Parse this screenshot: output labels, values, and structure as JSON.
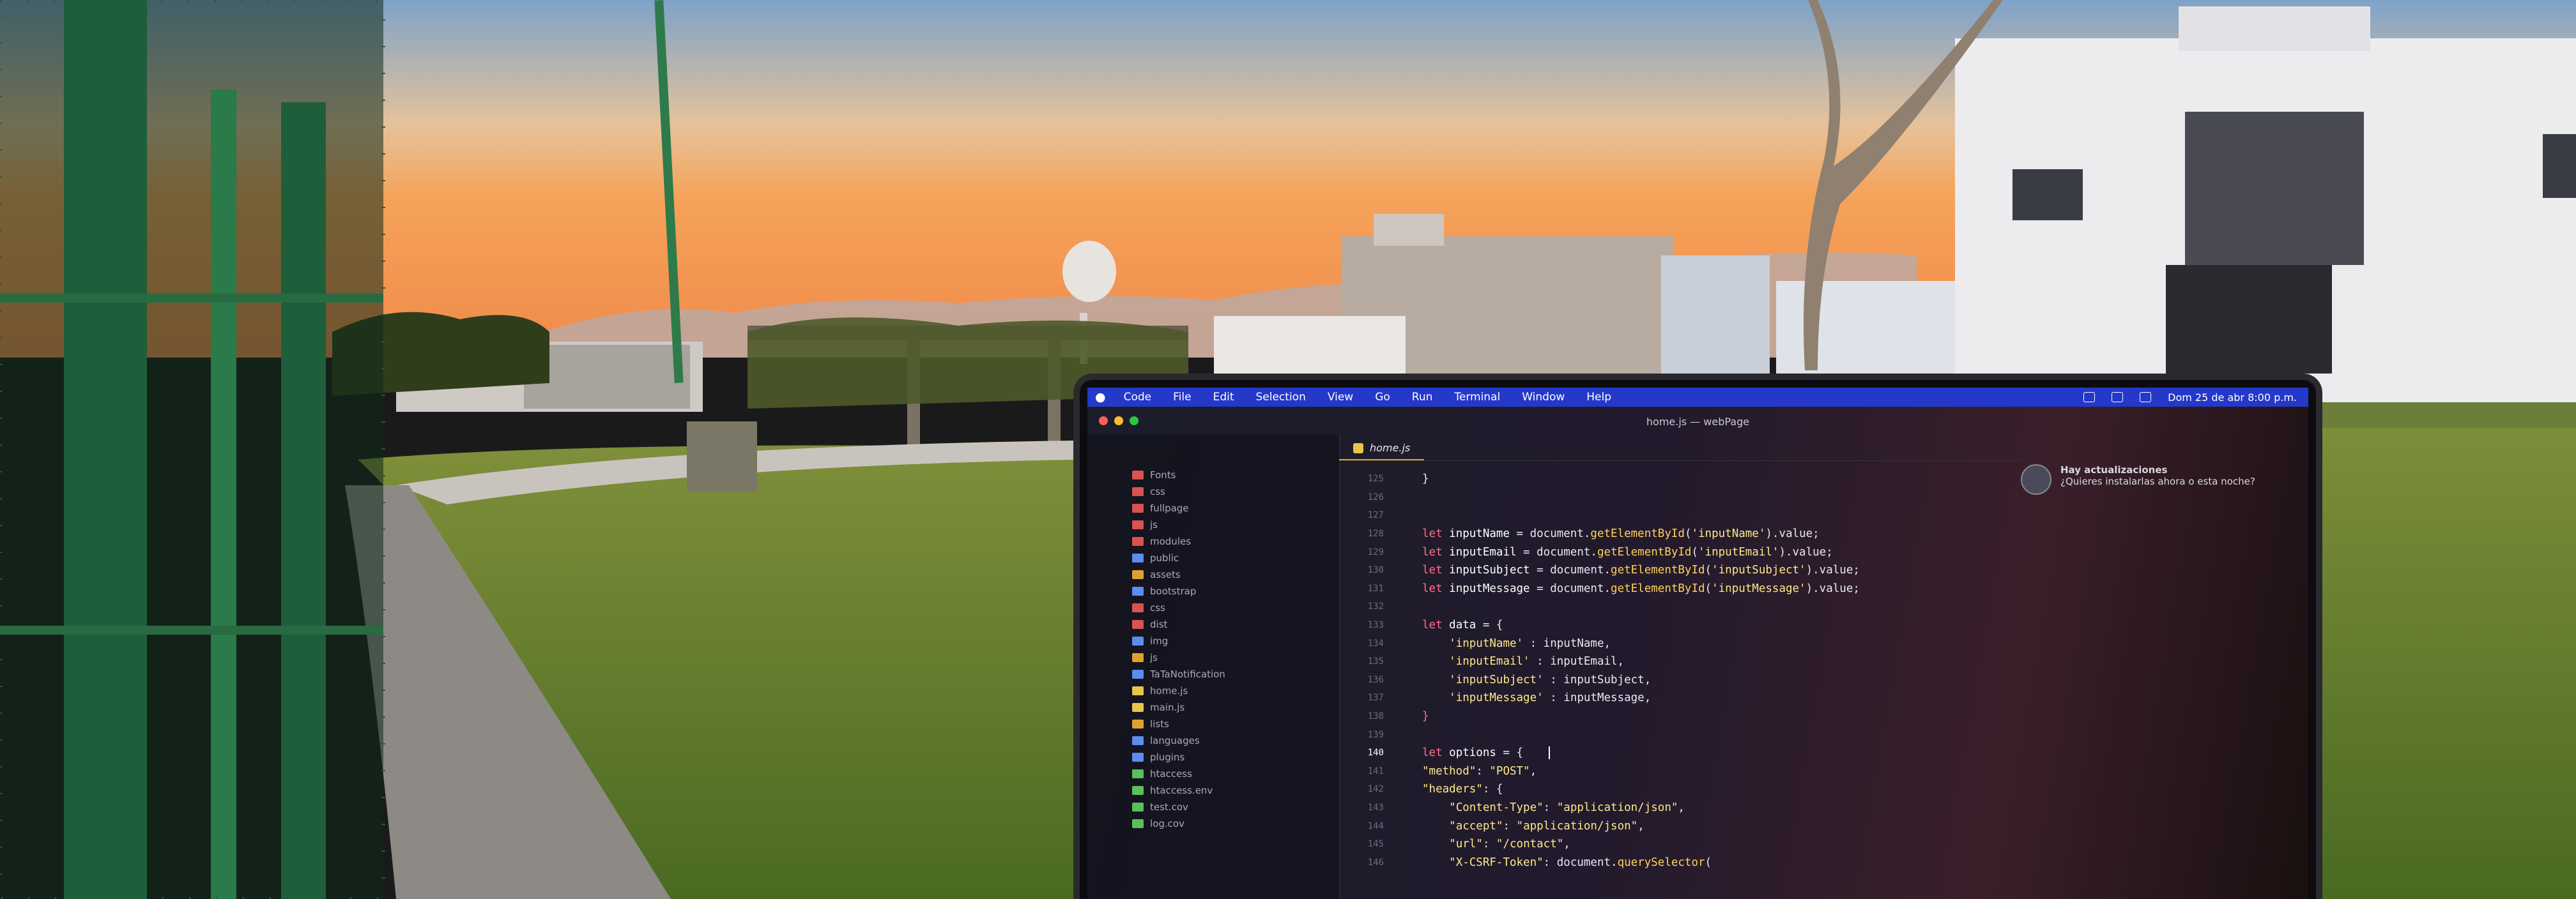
{
  "scene": {
    "description_colors": {
      "sky_top": "#7ea3c9",
      "sky_horizon": "#f5a35a",
      "grass": "#5b7a2a",
      "fence": "#1f5e3a"
    }
  },
  "laptop": {
    "menubar": {
      "items": [
        "Code",
        "File",
        "Edit",
        "Selection",
        "View",
        "Go",
        "Run",
        "Terminal",
        "Window",
        "Help"
      ],
      "datetime": "Dom 25 de abr  8:00 p.m."
    },
    "window_title": "home.js — webPage",
    "tab_label": "home.js",
    "notification": {
      "title": "Hay actualizaciones",
      "body": "¿Quieres instalarlas ahora o esta noche?"
    },
    "explorer": [
      {
        "label": "Fonts",
        "color": "#d9534f"
      },
      {
        "label": "css",
        "color": "#d9534f"
      },
      {
        "label": "fullpage",
        "color": "#d9534f"
      },
      {
        "label": "js",
        "color": "#d9534f"
      },
      {
        "label": "modules",
        "color": "#d9534f"
      },
      {
        "label": "public",
        "color": "#5b8def"
      },
      {
        "label": "assets",
        "color": "#e0a030"
      },
      {
        "label": "bootstrap",
        "color": "#5b8def"
      },
      {
        "label": "css",
        "color": "#d9534f"
      },
      {
        "label": "dist",
        "color": "#d9534f"
      },
      {
        "label": "img",
        "color": "#5b8def"
      },
      {
        "label": "js",
        "color": "#e0a030"
      },
      {
        "label": "TaTaNotification",
        "color": "#5b8def"
      },
      {
        "label": "home.js",
        "color": "#e8c44a"
      },
      {
        "label": "main.js",
        "color": "#e8c44a"
      },
      {
        "label": "lists",
        "color": "#e0a030"
      },
      {
        "label": "languages",
        "color": "#5b8def"
      },
      {
        "label": "plugins",
        "color": "#5b8def"
      },
      {
        "label": "htaccess",
        "color": "#5bbf5b"
      },
      {
        "label": "htaccess.env",
        "color": "#5bbf5b"
      },
      {
        "label": "test.cov",
        "color": "#5bbf5b"
      },
      {
        "label": "log.cov",
        "color": "#5bbf5b"
      }
    ],
    "code_lines": [
      {
        "n": "125",
        "tokens": [
          [
            "pun",
            "}"
          ]
        ]
      },
      {
        "n": "126",
        "tokens": []
      },
      {
        "n": "127",
        "tokens": []
      },
      {
        "n": "128",
        "tokens": [
          [
            "kw",
            "let "
          ],
          [
            "var",
            "inputName"
          ],
          [
            "pun",
            " = document."
          ],
          [
            "fn",
            "getElementById"
          ],
          [
            "pun",
            "("
          ],
          [
            "str",
            "'inputName'"
          ],
          [
            "pun",
            ").value;"
          ]
        ]
      },
      {
        "n": "129",
        "tokens": [
          [
            "kw",
            "let "
          ],
          [
            "var",
            "inputEmail"
          ],
          [
            "pun",
            " = document."
          ],
          [
            "fn",
            "getElementById"
          ],
          [
            "pun",
            "("
          ],
          [
            "str",
            "'inputEmail'"
          ],
          [
            "pun",
            ").value;"
          ]
        ]
      },
      {
        "n": "130",
        "tokens": [
          [
            "kw",
            "let "
          ],
          [
            "var",
            "inputSubject"
          ],
          [
            "pun",
            " = document."
          ],
          [
            "fn",
            "getElementById"
          ],
          [
            "pun",
            "("
          ],
          [
            "str",
            "'inputSubject'"
          ],
          [
            "pun",
            ").value;"
          ]
        ]
      },
      {
        "n": "131",
        "tokens": [
          [
            "kw",
            "let "
          ],
          [
            "var",
            "inputMessage"
          ],
          [
            "pun",
            " = document."
          ],
          [
            "fn",
            "getElementById"
          ],
          [
            "pun",
            "("
          ],
          [
            "str",
            "'inputMessage'"
          ],
          [
            "pun",
            ").value;"
          ]
        ]
      },
      {
        "n": "132",
        "tokens": []
      },
      {
        "n": "133",
        "tokens": [
          [
            "kw",
            "let "
          ],
          [
            "var",
            "data"
          ],
          [
            "pun",
            " = {"
          ]
        ]
      },
      {
        "n": "134",
        "tokens": [
          [
            "pun",
            "    "
          ],
          [
            "str",
            "'inputName'"
          ],
          [
            "pun",
            " : inputName,"
          ]
        ]
      },
      {
        "n": "135",
        "tokens": [
          [
            "pun",
            "    "
          ],
          [
            "str",
            "'inputEmail'"
          ],
          [
            "pun",
            " : inputEmail,"
          ]
        ]
      },
      {
        "n": "136",
        "tokens": [
          [
            "pun",
            "    "
          ],
          [
            "str",
            "'inputSubject'"
          ],
          [
            "pun",
            " : inputSubject,"
          ]
        ]
      },
      {
        "n": "137",
        "tokens": [
          [
            "pun",
            "    "
          ],
          [
            "str",
            "'inputMessage'"
          ],
          [
            "pun",
            " : inputMessage,"
          ]
        ]
      },
      {
        "n": "138",
        "tokens": [
          [
            "kw",
            "}"
          ]
        ]
      },
      {
        "n": "139",
        "tokens": []
      },
      {
        "n": "140",
        "tokens": [
          [
            "kw",
            "let "
          ],
          [
            "var",
            "options"
          ],
          [
            "pun",
            " = {"
          ]
        ]
      },
      {
        "n": "141",
        "tokens": [
          [
            "str",
            "\"method\""
          ],
          [
            "pun",
            ": "
          ],
          [
            "str",
            "\"POST\""
          ],
          [
            "pun",
            ","
          ]
        ]
      },
      {
        "n": "142",
        "tokens": [
          [
            "str",
            "\"headers\""
          ],
          [
            "pun",
            ": {"
          ]
        ]
      },
      {
        "n": "143",
        "tokens": [
          [
            "pun",
            "    "
          ],
          [
            "str",
            "\"Content-Type\""
          ],
          [
            "pun",
            ": "
          ],
          [
            "str",
            "\"application/json\""
          ],
          [
            "pun",
            ","
          ]
        ]
      },
      {
        "n": "144",
        "tokens": [
          [
            "pun",
            "    "
          ],
          [
            "str",
            "\"accept\""
          ],
          [
            "pun",
            ": "
          ],
          [
            "str",
            "\"application/json\""
          ],
          [
            "pun",
            ","
          ]
        ]
      },
      {
        "n": "145",
        "tokens": [
          [
            "pun",
            "    "
          ],
          [
            "str",
            "\"url\""
          ],
          [
            "pun",
            ": "
          ],
          [
            "str",
            "\"/contact\""
          ],
          [
            "pun",
            ","
          ]
        ]
      },
      {
        "n": "146",
        "tokens": [
          [
            "pun",
            "    "
          ],
          [
            "str",
            "\"X-CSRF-Token\""
          ],
          [
            "pun",
            ": document."
          ],
          [
            "fn",
            "querySelector"
          ],
          [
            "pun",
            "("
          ]
        ]
      }
    ],
    "current_line": "140"
  }
}
